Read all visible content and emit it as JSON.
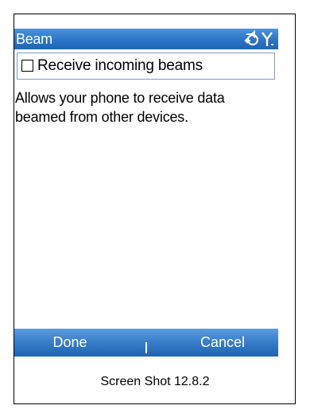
{
  "title_bar": {
    "title": "Beam",
    "icons": [
      "connectivity-icon",
      "signal-icon"
    ]
  },
  "setting": {
    "checkbox_label": "Receive incoming beams",
    "checked": false
  },
  "description": "Allows your phone to receive data beamed from other devices.",
  "softkeys": {
    "left": "Done",
    "right": "Cancel"
  },
  "caption": "Screen Shot 12.8.2",
  "colors": {
    "title_bar": "#2e77c8",
    "softkey_bar": "#3a80cc",
    "checkbox_border": "#7a9cc8"
  }
}
